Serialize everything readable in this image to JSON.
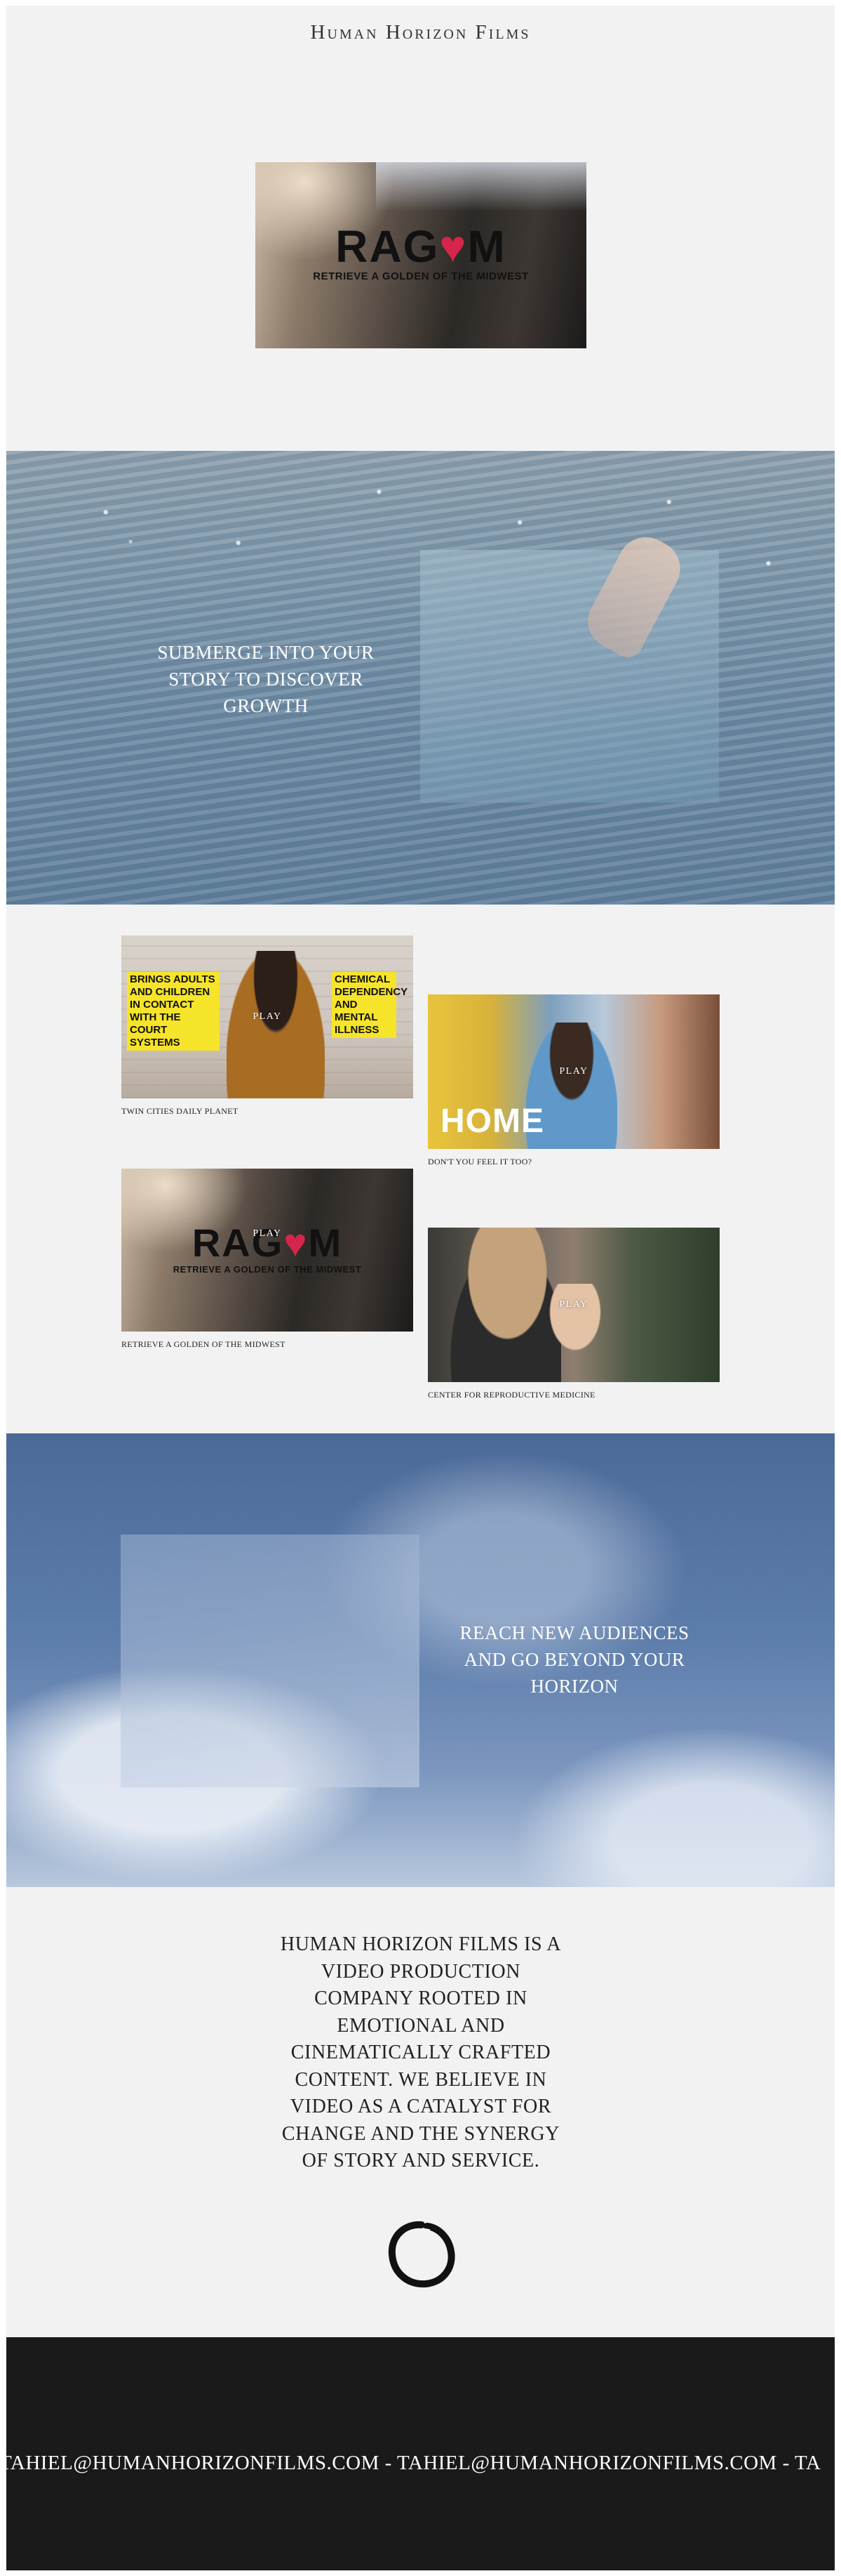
{
  "header": {
    "site_title": "Human Horizon Films"
  },
  "hero": {
    "logo_word": "RAGOM",
    "logo_sub": "RETRIEVE A GOLDEN OF THE MIDWEST"
  },
  "water_section": {
    "caption": "SUBMERGE INTO YOUR STORY TO DISCOVER GROWTH"
  },
  "videos": [
    {
      "title": "TWIN CITIES DAILY PLANET",
      "play": "PLAY",
      "overlay_left": "BRINGS ADULTS AND CHILDREN IN CONTACT WITH THE COURT SYSTEMS",
      "overlay_right": "CHEMICAL DEPENDENCY AND MENTAL ILLNESS"
    },
    {
      "title": "DON'T YOU FEEL IT TOO?",
      "play": "PLAY",
      "overlay_text": "HOME"
    },
    {
      "title": "RETRIEVE A GOLDEN OF THE MIDWEST",
      "play": "PLAY",
      "logo_word": "RAGOM",
      "logo_sub": "RETRIEVE A GOLDEN OF THE MIDWEST"
    },
    {
      "title": "CENTER FOR REPRODUCTIVE MEDICINE",
      "play": "PLAY"
    }
  ],
  "sky_section": {
    "caption": "REACH NEW AUDIENCES AND GO BEYOND YOUR HORIZON"
  },
  "about": {
    "text": "HUMAN HORIZON FILMS IS A VIDEO PRODUCTION COMPANY ROOTED IN EMOTIONAL AND CINEMATICALLY CRAFTED CONTENT. WE BELIEVE IN VIDEO AS A CATALYST FOR CHANGE AND THE SYNERGY OF STORY AND SERVICE."
  },
  "footer": {
    "marquee": "TAHIEL@HUMANHORIZONFILMS.COM - TAHIEL@HUMANHORIZONFILMS.COM - TA"
  },
  "colors": {
    "page_bg": "#f2f2f2",
    "footer_bg": "#1a1a1a",
    "ragom_heart": "#d6254a",
    "highlight_yellow": "#f6e42a"
  },
  "icons": {
    "logo_mark": "enso-circle-icon",
    "ragom_heart": "heart-dog-icon"
  }
}
